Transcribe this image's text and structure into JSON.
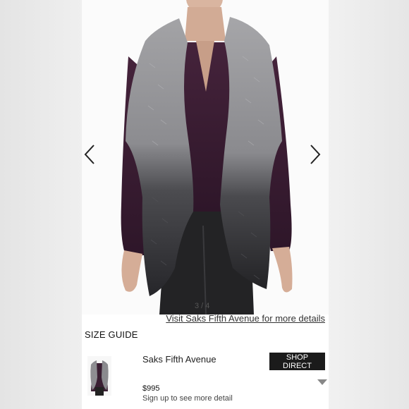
{
  "gallery": {
    "counter": "3 / 4",
    "prev_icon": "chevron-left-icon",
    "next_icon": "chevron-right-icon"
  },
  "links": {
    "visit": "Visit Saks Fifth Avenue for more details"
  },
  "size_guide": "SIZE GUIDE",
  "offer": {
    "seller": "Saks Fifth Avenue",
    "button": "SHOP DIRECT",
    "price": "$995",
    "signup": "Sign up to see more detail",
    "expand_icon": "caret-down-icon"
  },
  "colors": {
    "button_bg": "#1b1b1b",
    "blouse": "#3a1f33",
    "fur_light": "#9a9a9c",
    "fur_dark": "#2c2c2e"
  }
}
